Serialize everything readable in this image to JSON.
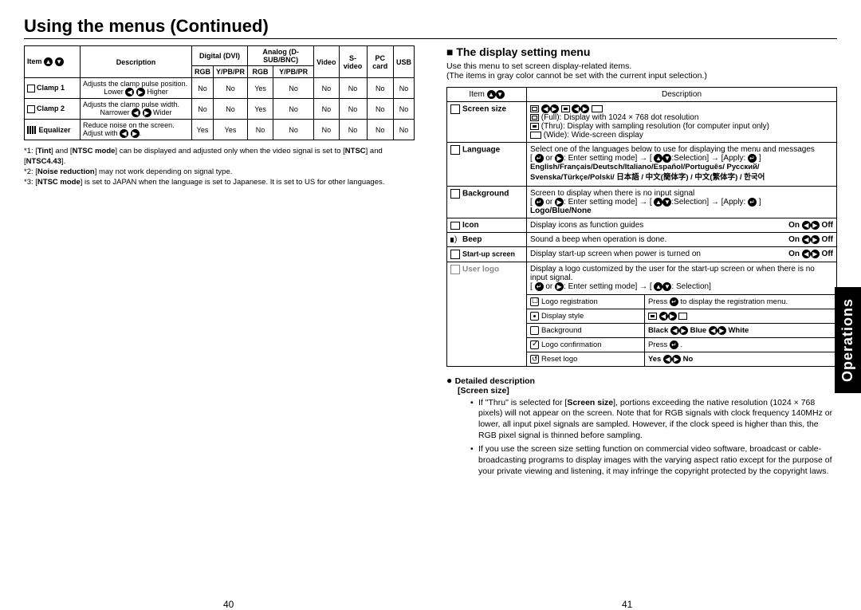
{
  "page_title": "Using the menus (Continued)",
  "side_tab": "Operations",
  "page_left": "40",
  "page_right": "41",
  "left_table": {
    "head": {
      "item": "Item",
      "desc": "Description",
      "dig": "Digital (DVI)",
      "ana": "Analog (D-SUB/BNC)",
      "video": "Video",
      "svideo": "S-video",
      "pccard": "PC card",
      "usb": "USB",
      "rgb1": "RGB",
      "ypbpr1": "Y/PB/PR",
      "rgb2": "RGB",
      "ypbpr2": "Y/PB/PR"
    },
    "rows": [
      {
        "name": "Clamp 1",
        "desc_main": "Adjusts the clamp pulse position.",
        "desc_left": "Lower",
        "desc_right": "Higher",
        "v": [
          "No",
          "No",
          "Yes",
          "No",
          "No",
          "No",
          "No",
          "No"
        ]
      },
      {
        "name": "Clamp 2",
        "desc_main": "Adjusts the clamp pulse width.",
        "desc_left": "Narrower",
        "desc_right": "Wider",
        "v": [
          "No",
          "No",
          "Yes",
          "No",
          "No",
          "No",
          "No",
          "No"
        ]
      },
      {
        "name": "Equalizer",
        "desc_main": "Reduce noise on the screen.",
        "desc_adjust": "Adjust with",
        "v": [
          "Yes",
          "Yes",
          "No",
          "No",
          "No",
          "No",
          "No",
          "No"
        ]
      }
    ]
  },
  "footnotes": {
    "n1a": "*1: [",
    "n1_tint": "Tint",
    "n1b": "] and [",
    "n1_ntsc": "NTSC mode",
    "n1c": "] can be displayed and adjusted only when the video signal is set to [",
    "n1_ntsc2": "NTSC",
    "n1d": "] and [",
    "n1_ntsc443": "NTSC4.43",
    "n1e": "].",
    "n2a": "*2: [",
    "n2_nr": "Noise reduction",
    "n2b": "] may not work depending on signal type.",
    "n3a": "*3: [",
    "n3_ntsc": "NTSC mode",
    "n3b": "] is set to JAPAN when the language is set to Japanese. It is set to US for other languages."
  },
  "right": {
    "heading": "The display setting menu",
    "intro1": "Use this menu to set screen display-related items.",
    "intro2": "(The items in gray color cannot be set with the current input selection.)",
    "th_item": "Item",
    "th_desc": "Description",
    "screen_size": {
      "label": "Screen size",
      "full": "(Full): Display with 1024 × 768 dot resolution",
      "thru": "(Thru): Display with sampling resolution (for computer input only)",
      "wide": "(Wide): Wide-screen display"
    },
    "language": {
      "label": "Language",
      "line1": "Select one of the languages below to use for displaying the menu and messages",
      "setting": ": Enter setting mode] → [",
      "selection": ":Selection] → [Apply:",
      "langs1": "English/Français/Deutsch/Italiano/Español/Português/ Русский/",
      "langs2": "Svenska/Türkçe/Polski/ 日本語 / 中文(簡体字) / 中文(繁体字) / 한국어"
    },
    "background": {
      "label": "Background",
      "line1": "Screen to display when there is no input signal",
      "setting": ": Enter setting mode] → [",
      "selection": ":Selection] → [Apply:",
      "opts": "Logo/Blue/None"
    },
    "icon_row": {
      "label": "Icon",
      "desc": "Display icons as function guides",
      "on": "On",
      "off": "Off"
    },
    "beep_row": {
      "label": "Beep",
      "desc": "Sound a beep when operation is done.",
      "on": "On",
      "off": "Off"
    },
    "startup_row": {
      "label": "Start-up screen",
      "desc": "Display start-up screen when power is turned on",
      "on": "On",
      "off": "Off"
    },
    "userlogo": {
      "label": "User logo",
      "line1": "Display a logo customized by the user for the start-up screen or when there is no input signal.",
      "setting": ": Enter setting mode] → [",
      "selection": ": Selection]",
      "reg_l": "Logo registration",
      "reg_r": "Press",
      "reg_r2": "to display the registration menu.",
      "style_l": "Display style",
      "bg_l": "Background",
      "bg_black": "Black",
      "bg_blue": "Blue",
      "bg_white": "White",
      "conf_l": "Logo confirmation",
      "conf_r": "Press",
      "reset_l": "Reset logo",
      "reset_yes": "Yes",
      "reset_no": "No"
    },
    "detailed": {
      "head": "Detailed description",
      "sub": "[Screen size]",
      "b1a": "If \"Thru\" is selected for [",
      "b1_ss": "Screen size",
      "b1b": "], portions exceeding the native resolution (1024 × 768 pixels) will not appear on the screen. Note that for RGB signals with clock frequency 140MHz or lower, all input pixel signals are sampled. However, if the clock speed is higher than this, the RGB pixel signal is thinned before sampling.",
      "b2": "If you use the screen size setting function on commercial video software, broadcast or cable-broadcasting programs to display images with the varying aspect ratio except for the purpose of your private viewing and listening, it may infringe the copyright protected by the copyright laws."
    }
  }
}
